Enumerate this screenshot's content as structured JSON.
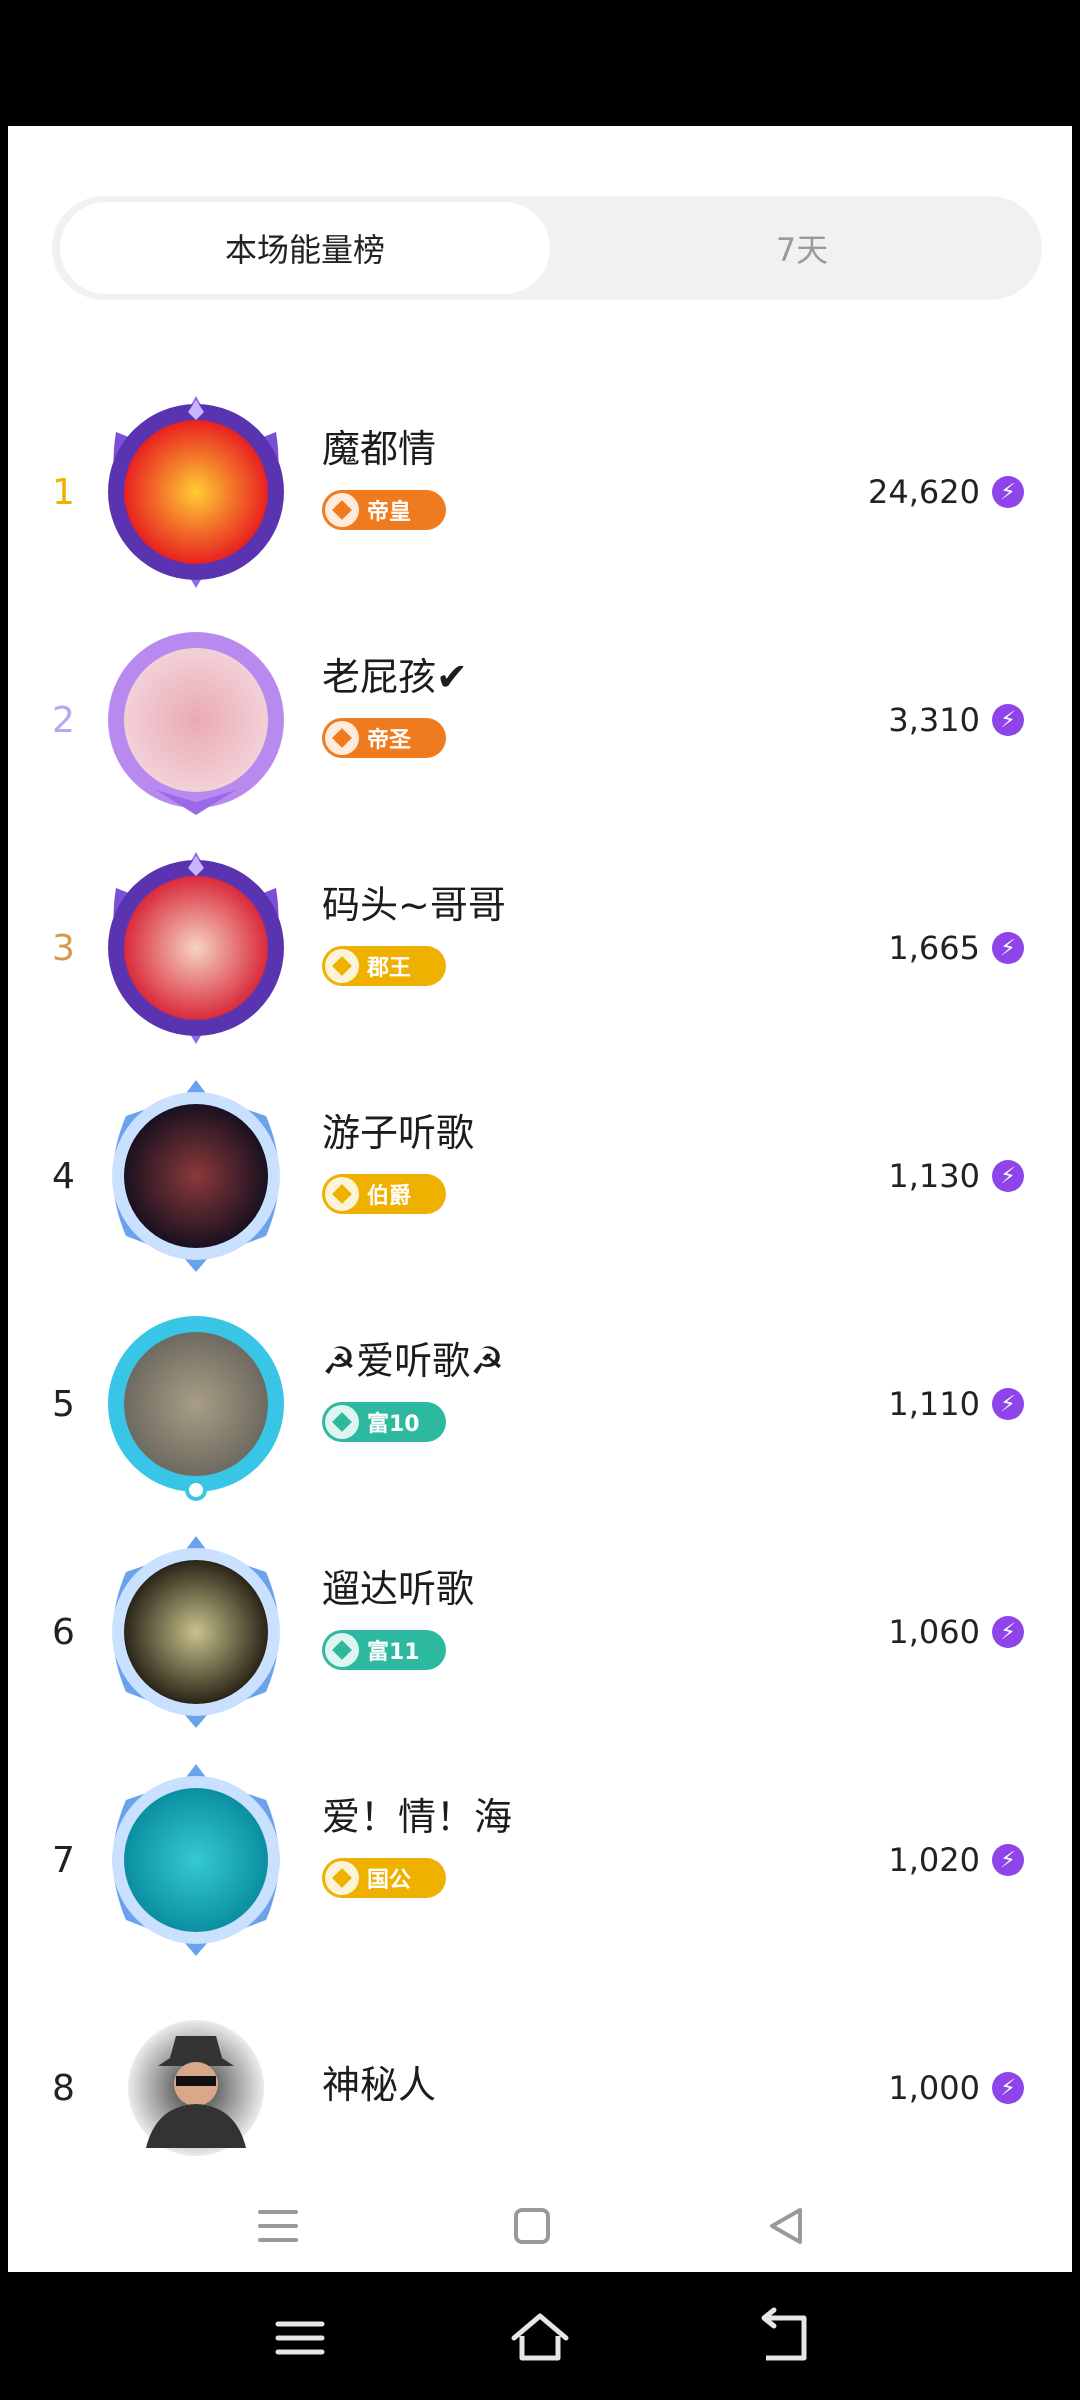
{
  "tabs": [
    {
      "label": "本场能量榜",
      "active": true
    },
    {
      "label": "7天",
      "active": false
    }
  ],
  "colors": {
    "accent": "#8e44e8",
    "rank1": "#f0b400",
    "rank2": "#b7a7f0",
    "rank3": "#d79a4a"
  },
  "leaderboard": [
    {
      "rank": "1",
      "name": "魔都情",
      "badge": "帝皇",
      "badge_color": "#f07a1e",
      "score": "24,620",
      "frame": "purple-crown",
      "avatar_colors": [
        "#e82020",
        "#ffcc33"
      ]
    },
    {
      "rank": "2",
      "name": "老屁孩✔",
      "badge": "帝圣",
      "badge_color": "#f07a1e",
      "score": "3,310",
      "frame": "purple-ring",
      "avatar_colors": [
        "#f3d1d6",
        "#e9a9b6"
      ]
    },
    {
      "rank": "3",
      "name": "码头~哥哥",
      "badge": "郡王",
      "badge_color": "#f0b000",
      "score": "1,665",
      "frame": "purple-crown",
      "avatar_colors": [
        "#d92a3a",
        "#f6d3c2"
      ]
    },
    {
      "rank": "4",
      "name": "游子听歌",
      "badge": "伯爵",
      "badge_color": "#f0b000",
      "score": "1,130",
      "frame": "blue-shield",
      "avatar_colors": [
        "#1a1020",
        "#8a3a3a"
      ]
    },
    {
      "rank": "5",
      "name": "☭爱听歌☭",
      "badge": "富10",
      "badge_color": "#2db8a0",
      "score": "1,110",
      "frame": "cyan-ring",
      "avatar_colors": [
        "#6e6a60",
        "#a89e86"
      ]
    },
    {
      "rank": "6",
      "name": "遛达听歌",
      "badge": "富11",
      "badge_color": "#2db8a0",
      "score": "1,060",
      "frame": "blue-shield",
      "avatar_colors": [
        "#2a2418",
        "#c9c38d"
      ]
    },
    {
      "rank": "7",
      "name": "爱！情！海",
      "badge": "国公",
      "badge_color": "#f0b000",
      "score": "1,020",
      "frame": "blue-shield",
      "avatar_colors": [
        "#0a8fa0",
        "#36c9d6"
      ]
    },
    {
      "rank": "8",
      "name": "神秘人",
      "badge": "",
      "badge_color": "",
      "score": "1,000",
      "frame": "none",
      "avatar_colors": [
        "#ececec",
        "#333333"
      ]
    }
  ],
  "app_nav": [
    {
      "icon": "menu-icon"
    },
    {
      "icon": "home-square-icon"
    },
    {
      "icon": "back-triangle-icon"
    }
  ],
  "system_nav": [
    {
      "icon": "menu-icon"
    },
    {
      "icon": "home-icon"
    },
    {
      "icon": "back-icon"
    }
  ]
}
